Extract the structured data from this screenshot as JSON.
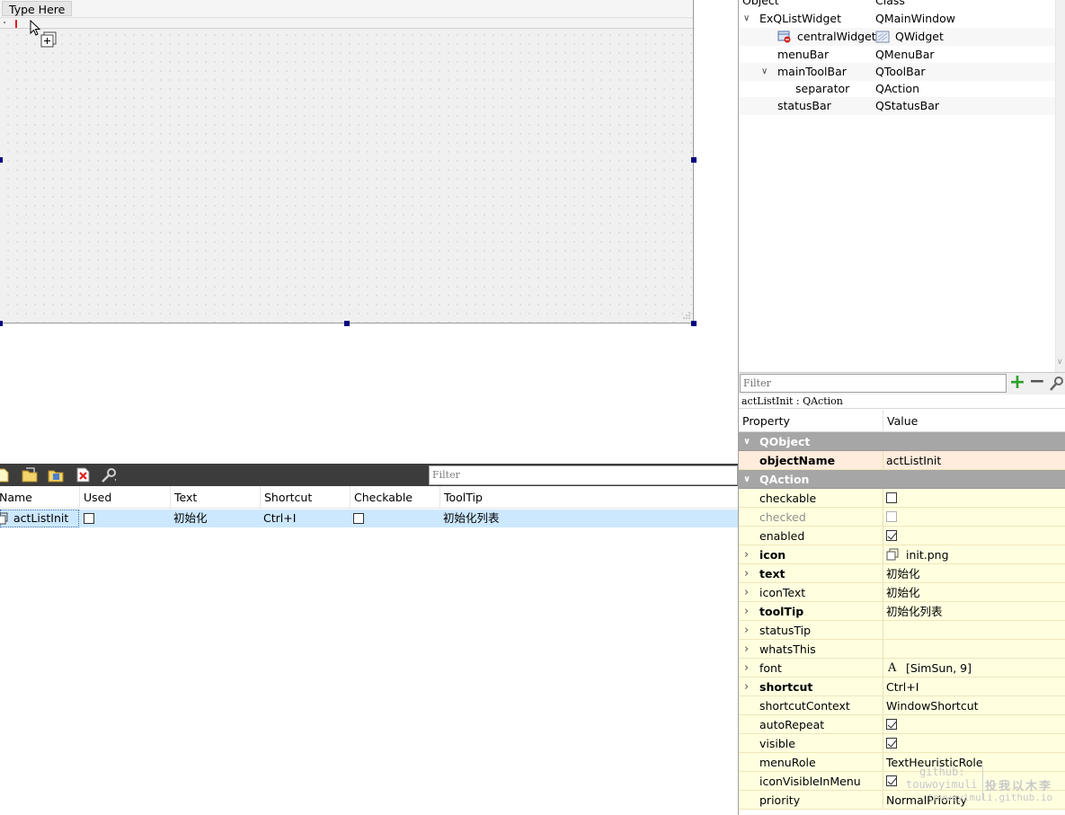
{
  "form": {
    "menu_placeholder": "Type Here"
  },
  "action_editor": {
    "filter_placeholder": "Filter",
    "columns": [
      "Name",
      "Used",
      "Text",
      "Shortcut",
      "Checkable",
      "ToolTip"
    ],
    "rows": [
      {
        "name": "actListInit",
        "used": false,
        "text": "初始化",
        "shortcut": "Ctrl+I",
        "checkable": false,
        "tooltip": "初始化列表"
      }
    ]
  },
  "object_inspector": {
    "header_object": "Object",
    "header_class": "Class",
    "items": [
      {
        "name": "ExQListWidget",
        "class": "QMainWindow"
      },
      {
        "name": "centralWidget",
        "class": "QWidget"
      },
      {
        "name": "menuBar",
        "class": "QMenuBar"
      },
      {
        "name": "mainToolBar",
        "class": "QToolBar"
      },
      {
        "name": "separator",
        "class": "QAction"
      },
      {
        "name": "statusBar",
        "class": "QStatusBar"
      }
    ]
  },
  "property_editor": {
    "filter_placeholder": "Filter",
    "object_label": "actListInit : QAction",
    "header_property": "Property",
    "header_value": "Value",
    "groups": {
      "qobject": "QObject",
      "qaction": "QAction"
    },
    "object_name": {
      "label": "objectName",
      "value": "actListInit"
    },
    "props": [
      {
        "label": "checkable",
        "value": "",
        "check": false
      },
      {
        "label": "checked",
        "value": "",
        "check": false,
        "disabled": true
      },
      {
        "label": "enabled",
        "value": "",
        "check": true
      },
      {
        "label": "icon",
        "value": "init.png",
        "bold": true,
        "expand": true
      },
      {
        "label": "text",
        "value": "初始化",
        "bold": true,
        "expand": true
      },
      {
        "label": "iconText",
        "value": "初始化",
        "expand": true
      },
      {
        "label": "toolTip",
        "value": "初始化列表",
        "bold": true,
        "expand": true
      },
      {
        "label": "statusTip",
        "value": "",
        "expand": true
      },
      {
        "label": "whatsThis",
        "value": "",
        "expand": true
      },
      {
        "label": "font",
        "value": "[SimSun, 9]",
        "expand": true
      },
      {
        "label": "shortcut",
        "value": "Ctrl+I",
        "bold": true,
        "expand": true
      },
      {
        "label": "shortcutContext",
        "value": "WindowShortcut"
      },
      {
        "label": "autoRepeat",
        "value": "",
        "check": true
      },
      {
        "label": "visible",
        "value": "",
        "check": true
      },
      {
        "label": "menuRole",
        "value": "TextHeuristicRole"
      },
      {
        "label": "iconVisibleInMenu",
        "value": "",
        "check": true
      },
      {
        "label": "priority",
        "value": "NormalPriority"
      }
    ]
  },
  "watermark": {
    "line1": "github:",
    "line2": "touwoyimuli",
    "line3": "touwoyimuli.github.io",
    "seal": "投我以木李"
  }
}
